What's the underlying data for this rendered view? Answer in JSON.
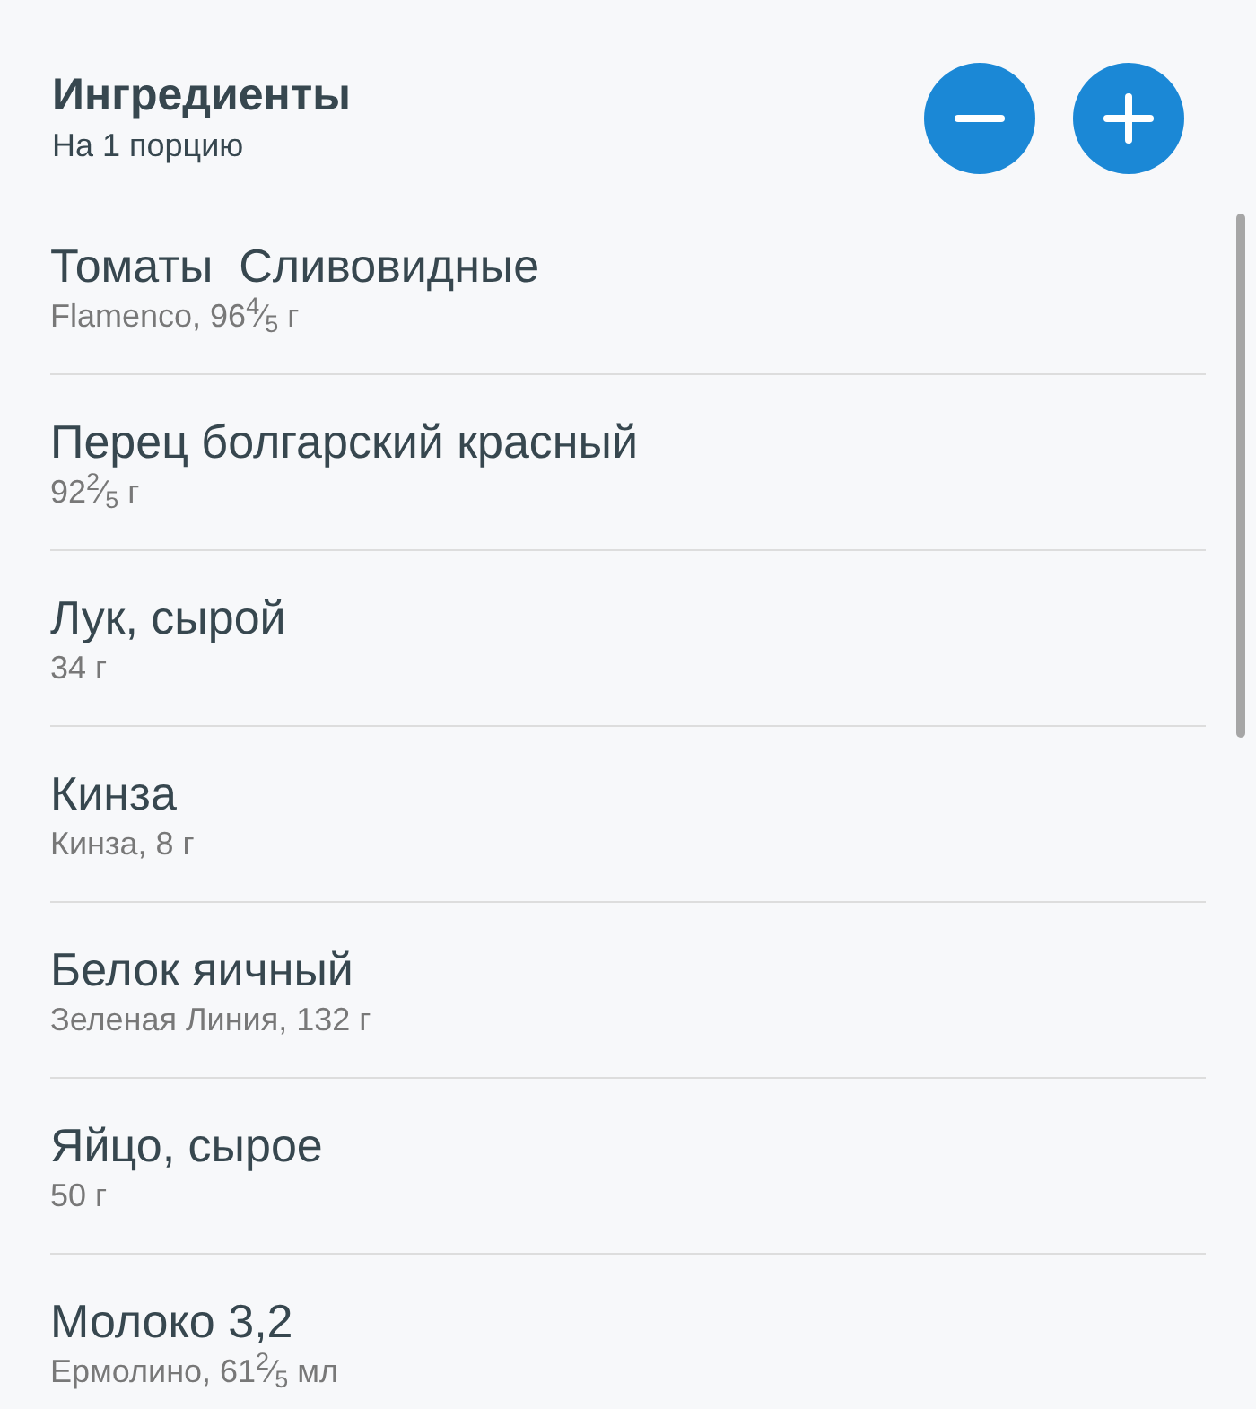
{
  "header": {
    "title": "Ингредиенты",
    "subtitle": "На 1 порцию",
    "buttons": [
      {
        "kind": "minus"
      },
      {
        "kind": "plus"
      }
    ]
  },
  "ingredients": [
    {
      "name": "Томаты  Сливовидные",
      "detail": "Flamenco, 96$^{4}$⁄$_{5}$ г"
    },
    {
      "name": "Перец болгарский красный",
      "detail": "92$^{2}$⁄$_{5}$ г"
    },
    {
      "name": "Лук, сырой",
      "detail": "34 г"
    },
    {
      "name": "Кинза",
      "detail": "Кинза, 8 г"
    },
    {
      "name": "Белок яичный",
      "detail": "Зеленая Линия, 132 г"
    },
    {
      "name": "Яйцо, сырое",
      "detail": "50 г"
    },
    {
      "name": "Молоко 3,2",
      "detail": "Ермолино, 61$^{2}$⁄$_{5}$ мл"
    }
  ]
}
